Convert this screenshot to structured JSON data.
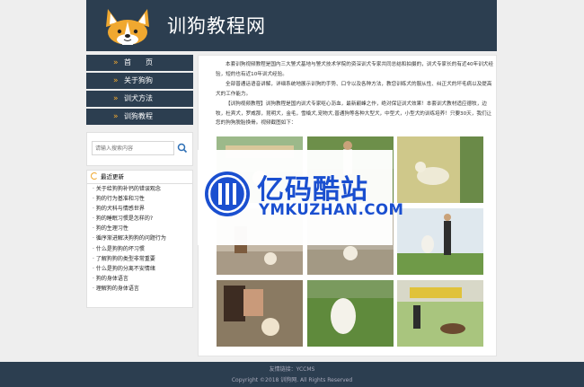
{
  "header": {
    "title": "训狗教程网"
  },
  "nav": [
    {
      "label": "首　　页"
    },
    {
      "label": "关于狗狗"
    },
    {
      "label": "训犬方法"
    },
    {
      "label": "训狗教程"
    }
  ],
  "search": {
    "placeholder": "请输入搜索内容"
  },
  "updates": {
    "heading": "最近更新",
    "items": [
      "关于给狗狗补钙的错误观念",
      "狗的行为基准和习性",
      "狗的犬科与情感世界",
      "狗的睡眠习惯是怎样的?",
      "狗的生理习性",
      "循序渐进解决狗狗的问题行为",
      "什么是狗狗的坏习惯",
      "了解狗狗的类型非常重要",
      "什么是狗的分离不安情绪",
      "狗的身体语言",
      "理解狗的身体语言"
    ]
  },
  "main": {
    "p1": "本套训狗视频教程是国内三大警犬基地与警犬技术学院的资深训犬专家共同总结和拍摄的，训犬专家长的有近40年训犬经验，短的也有近10年训犬经验。",
    "p2": "全部普通话语音讲解，详细系统地展示训狗的手势、口令以及各种方法，教您训练犬的服从性、纠正犬的坏毛病以及提高犬的工作能力。",
    "p3": "【训狗视频教程】训狗教程是国内训犬专家呕心沥血，最新巅峰之作，绝对保证训犬效果！本套训犬教材适应德牧，边牧，杜宾犬，罗威那，昆明犬，金毛，雪橇犬,宠物犬,普通狗等各种大型犬，中型犬，小型犬的训练培养！只要30天，我们让您的狗狗脱胎换骨。视频截图如下："
  },
  "watermark": {
    "cn": "亿码酷站",
    "en": "YMKUZHAN.COM"
  },
  "footer": {
    "links": "友情链接：YCCMS",
    "copyright": "Copyright ©2018 训狗网. All Rights Reserved"
  },
  "colors": {
    "header_bg": "#2c3e50",
    "accent": "#f0a830",
    "watermark_blue": "#1a4fd0"
  }
}
